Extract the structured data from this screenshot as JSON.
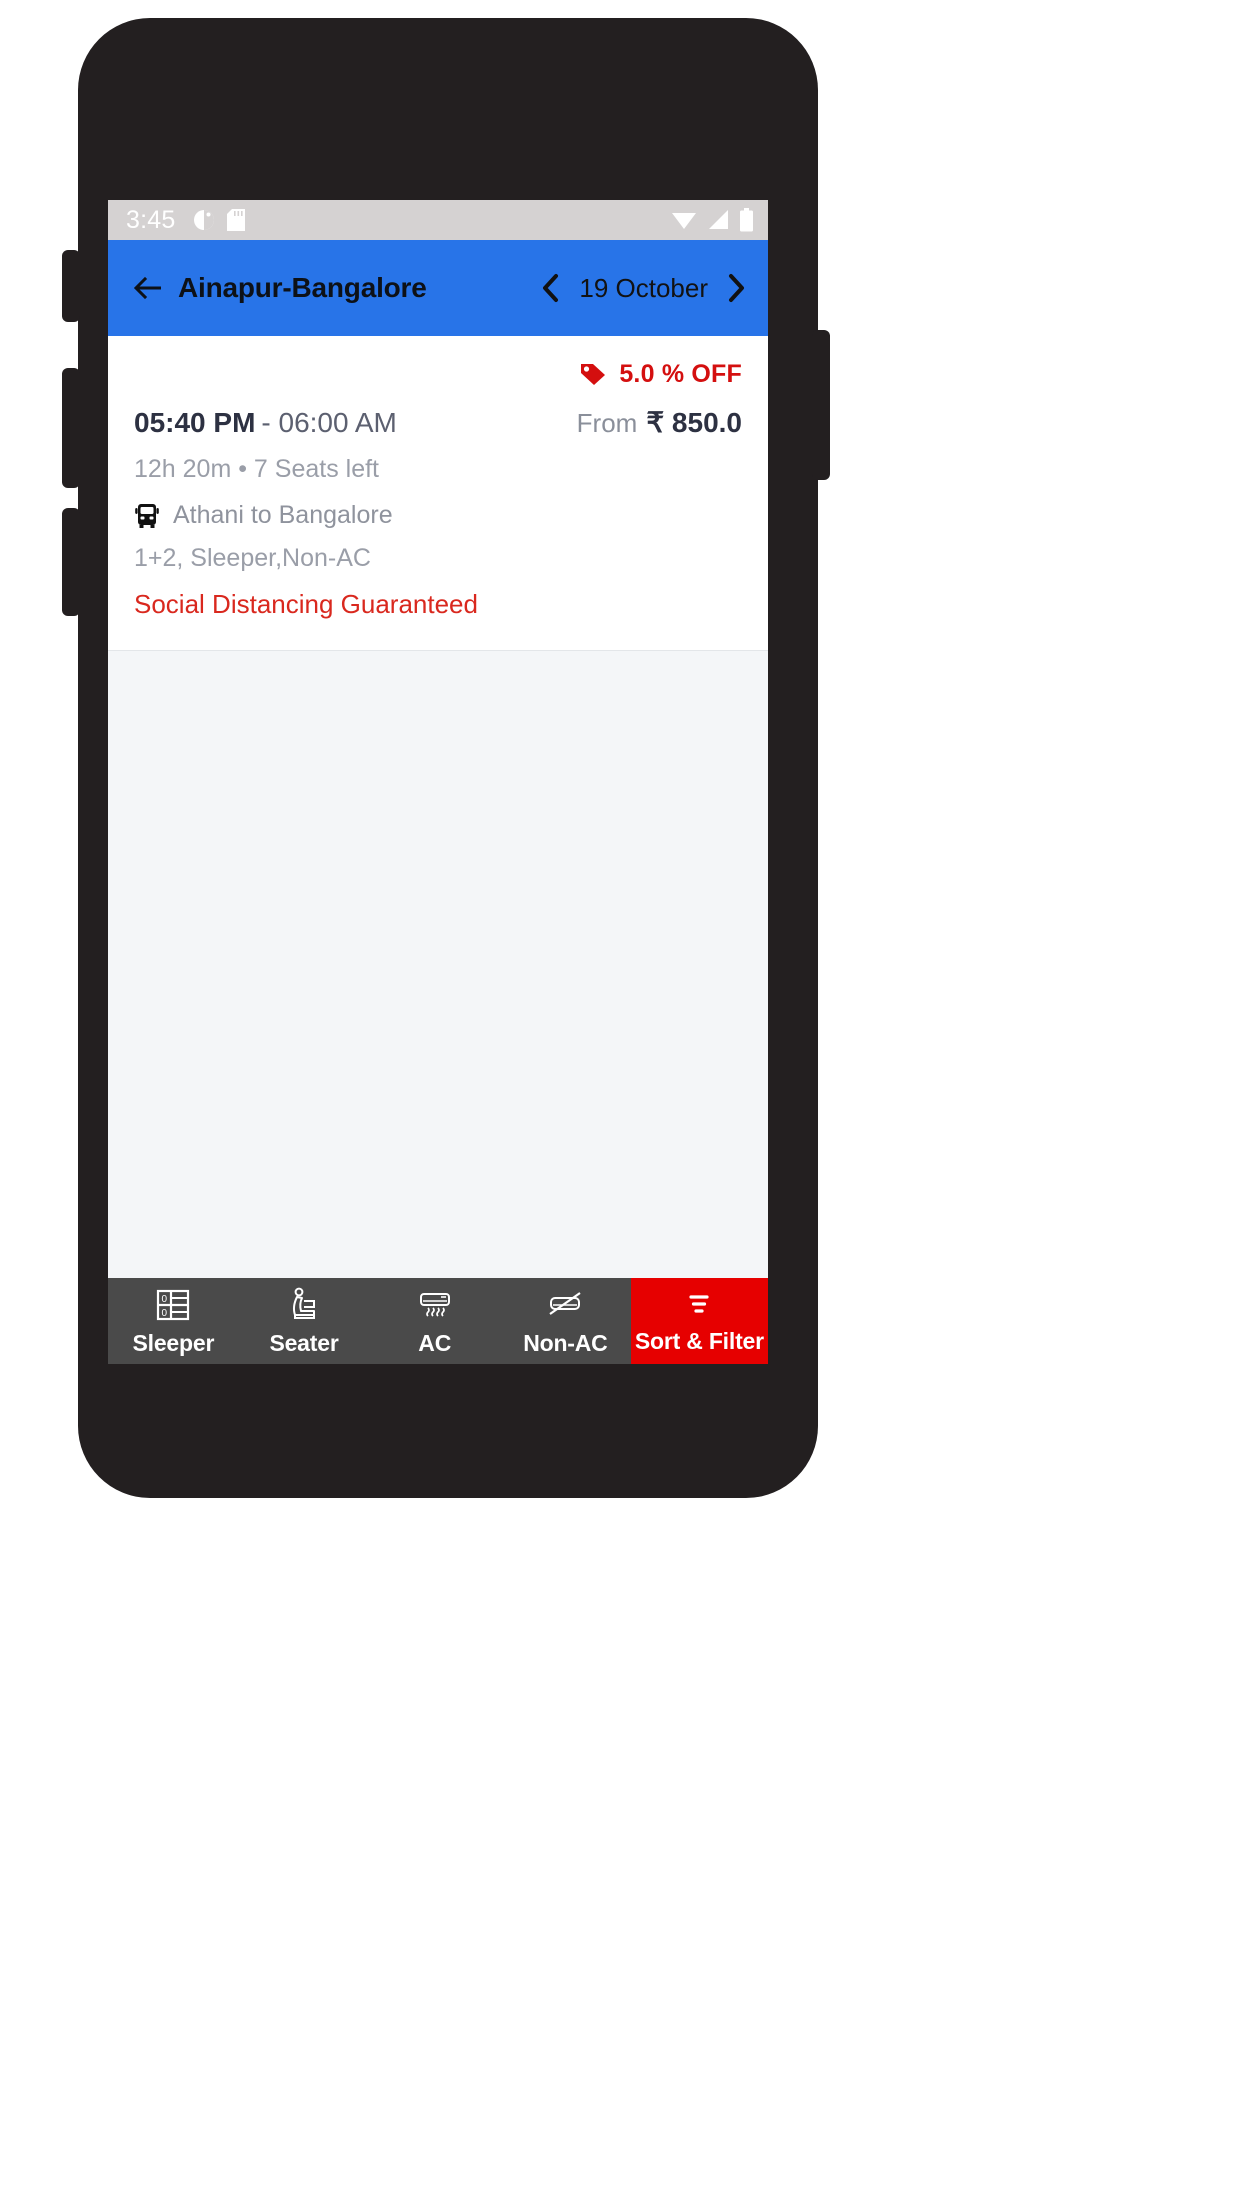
{
  "status_bar": {
    "time": "3:45",
    "left_icons": [
      "alarm-icon",
      "sd-card-icon"
    ],
    "right_icons": [
      "wifi-icon",
      "cellular-signal-icon",
      "battery-icon"
    ]
  },
  "app_bar": {
    "back_icon": "back-arrow-icon",
    "title": "Ainapur-Bangalore",
    "prev_icon": "chevron-left-icon",
    "date": "19 October",
    "next_icon": "chevron-right-icon",
    "background": "#2874e8"
  },
  "bus_card": {
    "offer": {
      "icon": "discount-tag-icon",
      "label": "5.0 % OFF",
      "color": "#d40f0f"
    },
    "departure_time": "05:40 PM",
    "arrival_time": "- 06:00 AM",
    "price_prefix": "From",
    "price": "₹ 850.0",
    "duration_seats": "12h 20m  •  7 Seats left",
    "route_icon": "bus-icon",
    "route": "Athani to Bangalore",
    "bus_type": "1+2, Sleeper,Non-AC",
    "distancing_note": "Social Distancing Guaranteed",
    "distancing_color": "#d9281e"
  },
  "filter_bar": {
    "background": "#4a4a4a",
    "accent": "#e60000",
    "items": [
      {
        "label": "Sleeper",
        "icon": "sleeper-berth-icon",
        "active": false
      },
      {
        "label": "Seater",
        "icon": "seat-icon",
        "active": false
      },
      {
        "label": "AC",
        "icon": "air-conditioner-icon",
        "active": false
      },
      {
        "label": "Non-AC",
        "icon": "air-conditioner-off-icon",
        "active": false
      },
      {
        "label": "Sort & Filter",
        "icon": "filter-icon",
        "active": true
      }
    ]
  },
  "nav_bar": {
    "back": "back-triangle-icon",
    "home": "home-circle-icon",
    "recents": "recents-square-icon"
  }
}
